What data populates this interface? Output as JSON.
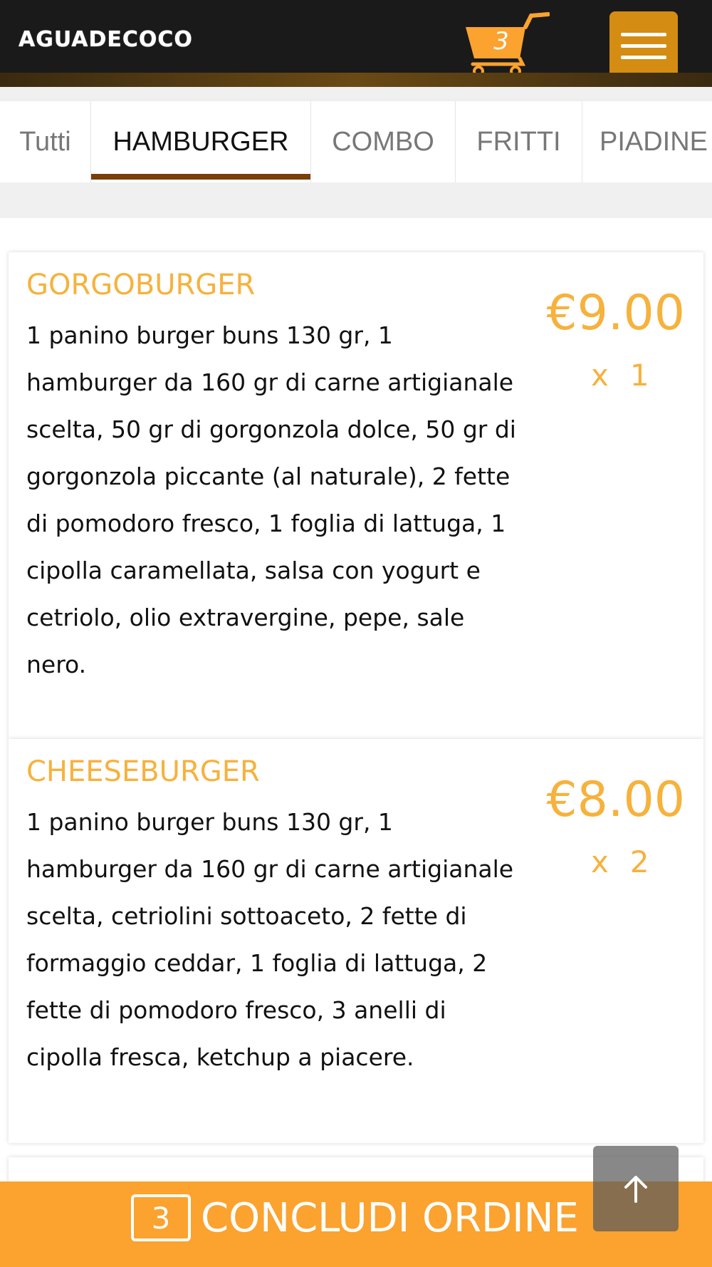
{
  "header": {
    "logo_text": "AGUADECOCO",
    "cart_count": "3",
    "cart_color": "#fba22f",
    "menu_button_color": "#d48c12",
    "icons": [
      "cart-icon",
      "hamburger-menu-icon"
    ]
  },
  "tabs": [
    {
      "label": "Tutti",
      "active": false
    },
    {
      "label": "HAMBURGER",
      "active": true
    },
    {
      "label": "COMBO",
      "active": false
    },
    {
      "label": "FRITTI",
      "active": false
    },
    {
      "label": "PIADINE",
      "active": false
    }
  ],
  "products": [
    {
      "name": "GORGOBURGER",
      "description": "1 panino burger buns 130 gr, 1 hamburger da 160 gr di carne artigianale scelta, 50 gr di gorgonzola dolce, 50 gr di gorgonzola piccante (al naturale), 2 fette di pomodoro fresco, 1 foglia di lattuga, 1 cipolla caramellata, salsa con yogurt e cetriolo, olio extravergine, pepe, sale nero.",
      "price": "€9.00",
      "qty_prefix": "x",
      "qty": "1"
    },
    {
      "name": "CHEESEBURGER",
      "description": "1 panino burger buns 130 gr, 1 hamburger da 160 gr di carne artigianale scelta, cetriolini sottoaceto, 2 fette di formaggio ceddar, 1 foglia di lattuga, 2 fette di pomodoro fresco, 3 anelli di cipolla fresca, ketchup a piacere.",
      "price": "€8.00",
      "qty_prefix": "x",
      "qty": "2"
    }
  ],
  "order_bar": {
    "count": "3",
    "label": "CONCLUDI ORDINE",
    "color": "#fba22f"
  },
  "scroll_top": {
    "icon": "arrow-up-icon"
  },
  "colors": {
    "accent": "#f6b23c",
    "header_bg": "#1a1a1a",
    "active_tab_underline": "#7a3e08"
  }
}
